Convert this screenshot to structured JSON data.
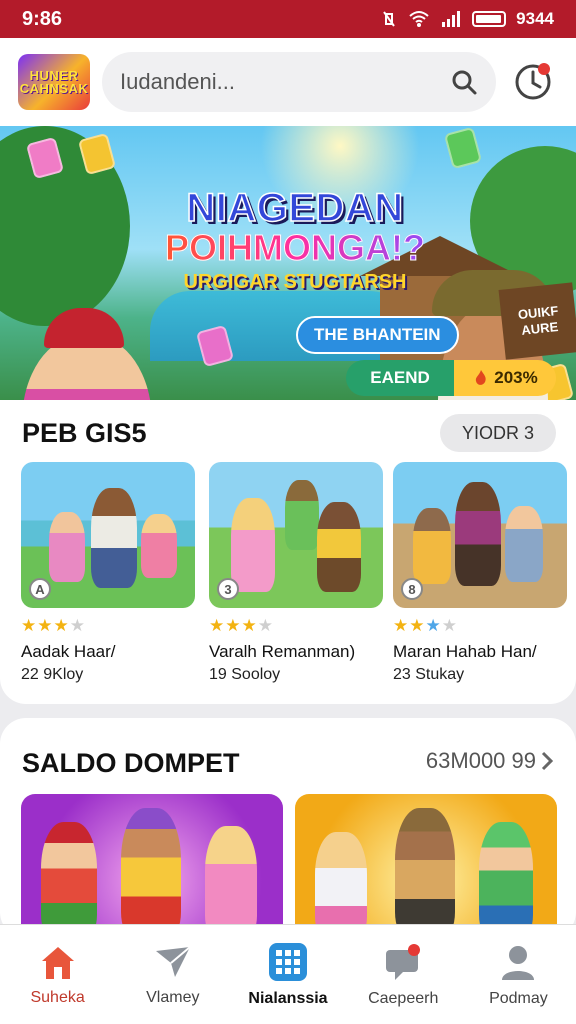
{
  "status_bar": {
    "time": "9:86",
    "battery": "9344"
  },
  "header": {
    "logo_line1": "HUNER",
    "logo_line2": "CAHNSAK",
    "search_placeholder": "Iudandeni..."
  },
  "banner": {
    "title_line1": "NIAGEDAN",
    "title_line2": "POIHMONGA!?",
    "title_line3": "URGIGAR STUGTARSH",
    "blue_pill": "THE BHANTEIN",
    "green_pill": "EAEND",
    "yellow_pill": "203%",
    "sign_line1": "OUIKF",
    "sign_line2": "AURE"
  },
  "section1": {
    "title": "PEB GIS5",
    "action": "YIODR 3",
    "games": [
      {
        "badge": "A",
        "stars": 3,
        "name": "Aadak Haar/",
        "sub": "22 9Kloy"
      },
      {
        "badge": "3",
        "stars": 3,
        "name": "Varalh Remanman)",
        "sub": "19 Sooloy"
      },
      {
        "badge": "8",
        "stars": 3,
        "name": "Maran Hahab Han/",
        "sub": "23 Stukay"
      }
    ]
  },
  "section2": {
    "title": "SALDO DOMPET",
    "action": "63M000 99"
  },
  "nav": [
    {
      "label": "Suheka",
      "icon": "home-icon"
    },
    {
      "label": "Vlamey",
      "icon": "paper-plane-icon"
    },
    {
      "label": "Nialanssia",
      "icon": "grid-icon"
    },
    {
      "label": "Caepeerh",
      "icon": "chat-icon"
    },
    {
      "label": "Podmay",
      "icon": "user-icon"
    }
  ],
  "colors": {
    "brand_red": "#b31b2a",
    "star_gold": "#f3b312",
    "nav_home": "#c0392b"
  }
}
